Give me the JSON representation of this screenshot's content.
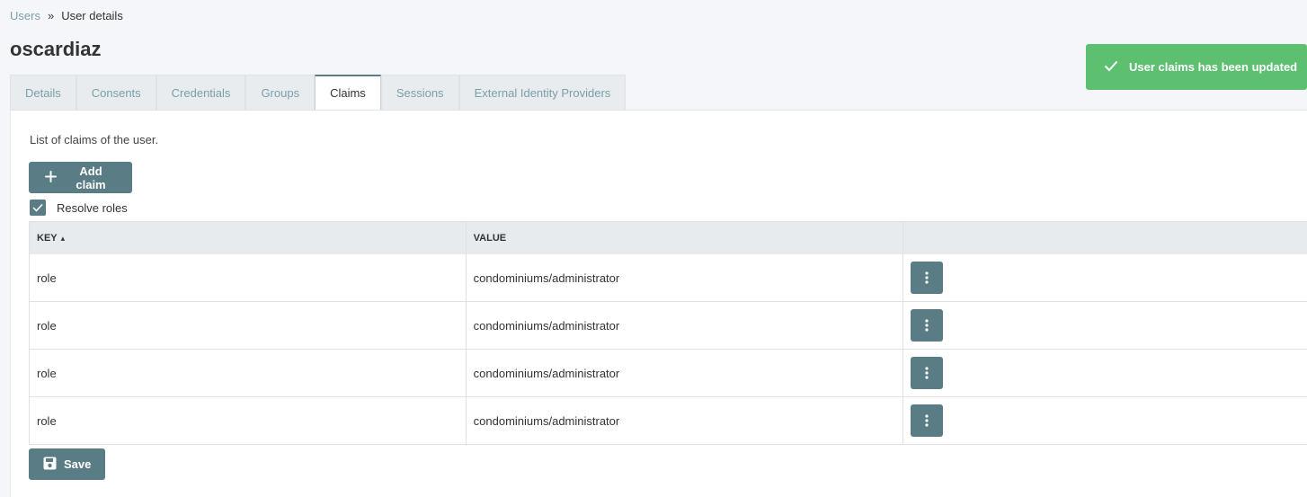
{
  "breadcrumb": {
    "parent": "Users",
    "separator": "»",
    "current": "User details"
  },
  "page_title": "oscardiaz",
  "tabs": [
    {
      "label": "Details",
      "active": false
    },
    {
      "label": "Consents",
      "active": false
    },
    {
      "label": "Credentials",
      "active": false
    },
    {
      "label": "Groups",
      "active": false
    },
    {
      "label": "Claims",
      "active": true
    },
    {
      "label": "Sessions",
      "active": false
    },
    {
      "label": "External Identity Providers",
      "active": false
    }
  ],
  "claims": {
    "description": "List of claims of the user.",
    "add_button": "Add claim",
    "resolve_roles": {
      "label": "Resolve roles",
      "checked": true
    },
    "table": {
      "headers": {
        "key": "KEY",
        "value": "VALUE",
        "sort_indicator": "▴"
      },
      "rows": [
        {
          "key": "role",
          "value": "condominiums/administrator"
        },
        {
          "key": "role",
          "value": "condominiums/administrator"
        },
        {
          "key": "role",
          "value": "condominiums/administrator"
        },
        {
          "key": "role",
          "value": "condominiums/administrator"
        }
      ]
    },
    "save_button": "Save"
  },
  "toast": {
    "message": "User claims has been updated",
    "icon": "check-icon"
  },
  "colors": {
    "primary": "#5a7c84",
    "success": "#5cc070",
    "link": "#7a9fa8"
  }
}
